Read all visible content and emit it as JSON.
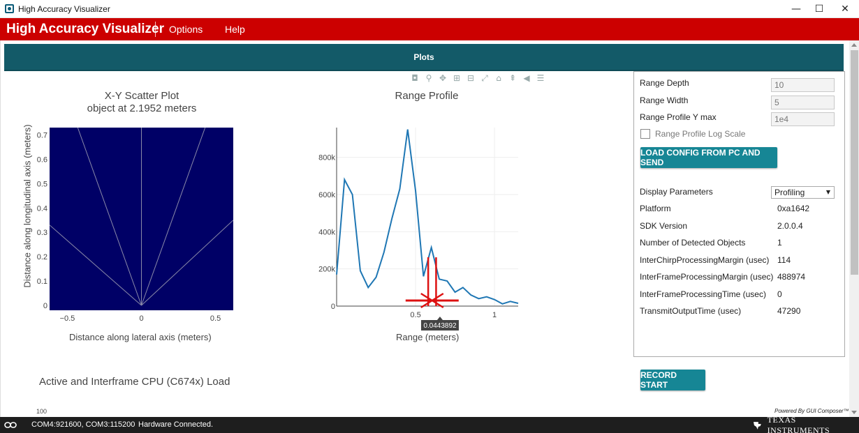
{
  "window": {
    "title": "High Accuracy Visualizer",
    "minimize_glyph": "—",
    "maximize_glyph": "☐",
    "close_glyph": "✕"
  },
  "menubar": {
    "brand": "High Accuracy Visualizer",
    "items": [
      "Options",
      "Help"
    ],
    "color": "#cc0000"
  },
  "tabs": {
    "active": "Plots",
    "color": "#135a68"
  },
  "modebar": {
    "icons": [
      "camera-icon",
      "zoom-icon",
      "pan-icon",
      "zoom-in-icon",
      "zoom-out-icon",
      "autoscale-icon",
      "reset-axes-icon",
      "spike-lines-icon",
      "hover-closest-icon",
      "hover-compare-icon"
    ]
  },
  "scatter": {
    "title_line1": "X-Y Scatter Plot",
    "title_line2": "object at 2.1952 meters",
    "xlabel": "Distance along lateral axis (meters)",
    "ylabel": "Distance along longitudinal axis (meters)",
    "xticks": [
      "−0.5",
      "0",
      "0.5"
    ],
    "yticks": [
      "0",
      "0.1",
      "0.2",
      "0.3",
      "0.4",
      "0.5",
      "0.6",
      "0.7"
    ],
    "background": "#000066"
  },
  "range_profile": {
    "title": "Range Profile",
    "xlabel": "Range (meters)",
    "xticks": [
      "0.5",
      "1"
    ],
    "yticks": [
      "0",
      "200k",
      "400k",
      "600k",
      "800k"
    ],
    "hover_label": "0.0443892",
    "line_color": "#1f77b4",
    "marker_color": "#dd1111"
  },
  "cpu_load": {
    "title": "Active and Interframe  CPU (C674x) Load",
    "ytick_top": "100"
  },
  "panel": {
    "range_depth_label": "Range Depth",
    "range_depth_value": "10",
    "range_width_label": "Range Width",
    "range_width_value": "5",
    "range_ymax_label": "Range Profile Y max",
    "range_ymax_value": "1e4",
    "log_scale_label": "Range Profile Log Scale",
    "load_button": "LOAD CONFIG FROM PC AND SEND",
    "display_params_label": "Display Parameters",
    "display_params_value": "Profiling",
    "rows": [
      {
        "label": "Platform",
        "value": "0xa1642"
      },
      {
        "label": "SDK Version",
        "value": "2.0.0.4"
      },
      {
        "label": "Number of Detected Objects",
        "value": "1"
      },
      {
        "label": "InterChirpProcessingMargin (usec)",
        "value": "114"
      },
      {
        "label": "InterFrameProcessingMargin (usec)",
        "value": "488974"
      },
      {
        "label": "InterFrameProcessingTime (usec)",
        "value": "0"
      },
      {
        "label": "TransmitOutputTime (usec)",
        "value": "47290"
      }
    ]
  },
  "record_button": "RECORD START",
  "powered_by": "Powered By GUI Composer™",
  "statusbar": {
    "ports": "COM4:921600, COM3:115200",
    "connection": "Hardware Connected.",
    "brand": "TEXAS INSTRUMENTS"
  },
  "chart_data": [
    {
      "type": "scatter",
      "title": "X-Y Scatter Plot",
      "subtitle": "object at 2.1952 meters",
      "xlabel": "Distance along lateral axis (meters)",
      "ylabel": "Distance along longitudinal axis (meters)",
      "xlim": [
        -0.62,
        0.62
      ],
      "ylim": [
        -0.02,
        0.73
      ],
      "x": [],
      "y": [],
      "sector_lines": [
        {
          "x": [
            0,
            -0.43
          ],
          "y": [
            0,
            0.73
          ]
        },
        {
          "x": [
            0,
            0.43
          ],
          "y": [
            0,
            0.73
          ]
        },
        {
          "x": [
            0,
            -0.62
          ],
          "y": [
            0,
            0.33
          ]
        },
        {
          "x": [
            0,
            0.62
          ],
          "y": [
            0,
            0.35
          ]
        },
        {
          "x": [
            0,
            0
          ],
          "y": [
            0,
            0.73
          ]
        }
      ]
    },
    {
      "type": "line",
      "title": "Range Profile",
      "xlabel": "Range (meters)",
      "ylabel": "",
      "xlim": [
        0,
        1.15
      ],
      "ylim": [
        0,
        960000
      ],
      "x": [
        0.0,
        0.05,
        0.1,
        0.15,
        0.2,
        0.25,
        0.3,
        0.35,
        0.4,
        0.45,
        0.5,
        0.55,
        0.6,
        0.65,
        0.7,
        0.75,
        0.8,
        0.85,
        0.9,
        0.95,
        1.0,
        1.05,
        1.1,
        1.15
      ],
      "y": [
        170000,
        680000,
        600000,
        190000,
        100000,
        155000,
        290000,
        470000,
        630000,
        950000,
        620000,
        160000,
        315000,
        145000,
        135000,
        75000,
        100000,
        60000,
        40000,
        50000,
        35000,
        12000,
        25000,
        15000
      ],
      "markers": [
        0.58,
        0.63
      ]
    }
  ]
}
